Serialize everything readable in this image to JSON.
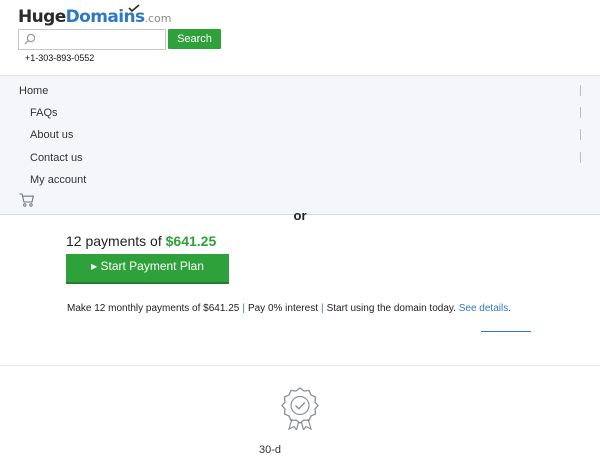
{
  "logo": {
    "part1": "Huge",
    "part2": "Domains",
    "part3": ".com"
  },
  "search": {
    "placeholder": "",
    "value": "",
    "button_label": "Search"
  },
  "phone": "+1-303-893-0552",
  "nav": {
    "items": [
      {
        "label": "Home"
      },
      {
        "label": "FAQs"
      },
      {
        "label": "About us"
      },
      {
        "label": "Contact us"
      },
      {
        "label": "My account"
      }
    ]
  },
  "offer": {
    "or_text": "or",
    "payments_prefix": "12 payments of ",
    "payment_amount": "$641.25",
    "button_label": "▸ Start Payment Plan",
    "details": {
      "part1": "Make 12 monthly payments of $641.25",
      "part2": "Pay 0% interest",
      "part3": "Start using the domain today.",
      "link": "See details",
      "suffix": "."
    }
  },
  "bottom_text": "30-d",
  "colors": {
    "accent_green": "#2ea13a",
    "link_blue": "#2f78c4"
  }
}
